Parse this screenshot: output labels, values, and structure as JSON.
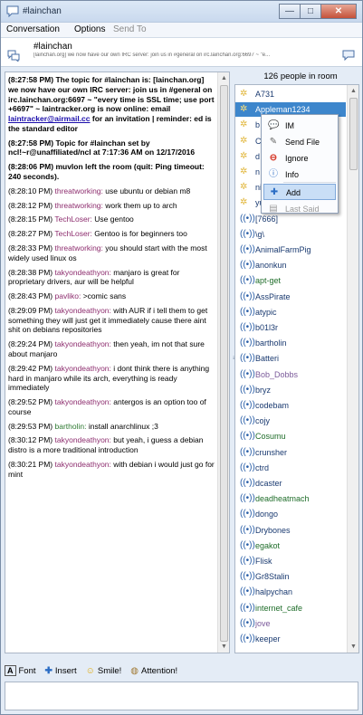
{
  "window": {
    "title": "#lainchan",
    "min": "—",
    "max": "□",
    "close": "✕"
  },
  "menu": {
    "conversation": "Conversation",
    "options": "Options",
    "send_to": "Send To"
  },
  "header": {
    "channel": "#lainchan",
    "topic": "[lainchan.org] we now have our own IRC server: join us in #general on irc.lainchan.org:6697 ~ \"e..."
  },
  "chat": [
    {
      "ts": "(8:27:58 PM)",
      "text": "The topic for #lainchan is: [lainchan.org] we now have our own IRC server: join us in #general on irc.lainchan.org:6697 ~ \"every time is SSL time; use port +6697\" ~ laintracker.org is now online: email",
      "link": "laintracker@airmail.cc",
      "tail": "for an invitation | reminder: ed is the standard editor"
    },
    {
      "ts": "(8:27:58 PM)",
      "text": "Topic for #lainchan set by ncl!~r@unaffiliated/ncl at 7:17:36 AM on 12/17/2016"
    },
    {
      "ts": "(8:28:06 PM)",
      "text": "muvlon left the room (quit: Ping timeout: 240 seconds)."
    },
    {
      "ts": "(8:28:10 PM)",
      "nick": "threatworking:",
      "msg": "use ubuntu or debian m8"
    },
    {
      "ts": "(8:28:12 PM)",
      "nick": "threatworking:",
      "msg": "work them up to arch"
    },
    {
      "ts": "(8:28:15 PM)",
      "nick": "TechLoser:",
      "msg": "Use gentoo"
    },
    {
      "ts": "(8:28:27 PM)",
      "nick": "TechLoser:",
      "msg": "Gentoo is for beginners too"
    },
    {
      "ts": "(8:28:33 PM)",
      "nick": "threatworking:",
      "msg": "you should start with the most widely used linux os"
    },
    {
      "ts": "(8:28:38 PM)",
      "nick": "takyondeathyon:",
      "msg": "manjaro is great for proprietary drivers, aur will be helpful"
    },
    {
      "ts": "(8:28:43 PM)",
      "nick": "pavliko:",
      "msg": ">comic sans"
    },
    {
      "ts": "(8:29:09 PM)",
      "nick": "takyondeathyon:",
      "msg": "with AUR if i tell them to get something they will just get it immediately cause there aint shit on debians repositories"
    },
    {
      "ts": "(8:29:24 PM)",
      "nick": "takyondeathyon:",
      "msg": "then yeah, im not that sure about manjaro"
    },
    {
      "ts": "(8:29:42 PM)",
      "nick": "takyondeathyon:",
      "msg": "i dont think there is anything hard in manjaro while its arch, everything is ready immediately"
    },
    {
      "ts": "(8:29:52 PM)",
      "nick": "takyondeathyon:",
      "msg": "antergos is an option too of course"
    },
    {
      "ts": "(8:29:53 PM)",
      "nick": "bartholin:",
      "msg": "install anarchlinux ;3",
      "green": true
    },
    {
      "ts": "(8:30:12 PM)",
      "nick": "takyondeathyon:",
      "msg": "but yeah, i guess a debian distro is a more traditional introduction"
    },
    {
      "ts": "(8:30:21 PM)",
      "nick": "takyondeathyon:",
      "msg": "with debian i would just go for mint"
    }
  ],
  "users": {
    "count_label": "126 people in room",
    "list": [
      {
        "name": "A731",
        "icon": "star"
      },
      {
        "name": "Appleman1234",
        "icon": "star",
        "selected": true
      },
      {
        "name": "b",
        "icon": "star"
      },
      {
        "name": "C",
        "icon": "star"
      },
      {
        "name": "d",
        "icon": "star"
      },
      {
        "name": "n",
        "icon": "star"
      },
      {
        "name": "ni",
        "icon": "star"
      },
      {
        "name": "yuuko",
        "icon": "star"
      },
      {
        "name": "[7666]",
        "icon": "wifi"
      },
      {
        "name": "\\g\\",
        "icon": "wifi"
      },
      {
        "name": "AnimalFarmPig",
        "icon": "wifi"
      },
      {
        "name": "anonkun",
        "icon": "wifi"
      },
      {
        "name": "apt-get",
        "icon": "wifi",
        "color": "g"
      },
      {
        "name": "AssPirate",
        "icon": "wifi"
      },
      {
        "name": "atypic",
        "icon": "wifi"
      },
      {
        "name": "b01l3r",
        "icon": "wifi"
      },
      {
        "name": "bartholin",
        "icon": "wifi"
      },
      {
        "name": "Batteri",
        "icon": "wifi"
      },
      {
        "name": "Bob_Dobbs",
        "icon": "wifi",
        "color": "p"
      },
      {
        "name": "bryz",
        "icon": "wifi"
      },
      {
        "name": "codebam",
        "icon": "wifi"
      },
      {
        "name": "cojy",
        "icon": "wifi"
      },
      {
        "name": "Cosumu",
        "icon": "wifi",
        "color": "g"
      },
      {
        "name": "crunsher",
        "icon": "wifi"
      },
      {
        "name": "ctrd",
        "icon": "wifi"
      },
      {
        "name": "dcaster",
        "icon": "wifi"
      },
      {
        "name": "deadheatmach",
        "icon": "wifi",
        "color": "g"
      },
      {
        "name": "dongo",
        "icon": "wifi"
      },
      {
        "name": "Drybones",
        "icon": "wifi"
      },
      {
        "name": "egakot",
        "icon": "wifi",
        "color": "g"
      },
      {
        "name": "Flisk",
        "icon": "wifi"
      },
      {
        "name": "Gr8Stalin",
        "icon": "wifi"
      },
      {
        "name": "halpychan",
        "icon": "wifi"
      },
      {
        "name": "internet_cafe",
        "icon": "wifi",
        "color": "g"
      },
      {
        "name": "jove",
        "icon": "wifi",
        "color": "p"
      },
      {
        "name": "keeper",
        "icon": "wifi"
      }
    ]
  },
  "context_menu": [
    {
      "label": "IM",
      "icon": "im"
    },
    {
      "label": "Send File",
      "icon": "file"
    },
    {
      "label": "Ignore",
      "icon": "ignore"
    },
    {
      "label": "Info",
      "icon": "info"
    },
    {
      "label": "Add",
      "icon": "add",
      "highlight": true
    },
    {
      "label": "Last Said",
      "icon": "last",
      "disabled": true
    }
  ],
  "toolbar": {
    "font": "Font",
    "insert": "Insert",
    "smile": "Smile!",
    "attention": "Attention!"
  },
  "colors": {
    "accent": "#3d86cc",
    "nick": "#8d2d6e"
  }
}
